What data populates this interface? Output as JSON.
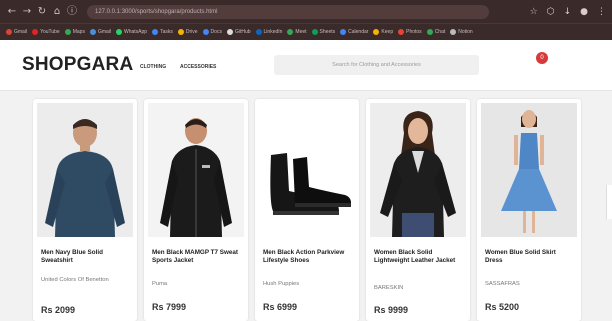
{
  "browser": {
    "url": "127.0.0.1:3000/sports/shopgara/products.html",
    "nav_icons": [
      "arrow-left-icon",
      "arrow-right-icon",
      "reload-icon",
      "home-icon",
      "lock-icon"
    ],
    "right_icons": [
      "star-icon",
      "extensions-icon",
      "downloads-icon",
      "profile-icon",
      "menu-icon"
    ],
    "bookmarks": [
      {
        "label": "Gmail",
        "color": "#d44638"
      },
      {
        "label": "YouTube",
        "color": "#e02424"
      },
      {
        "label": "Maps",
        "color": "#34a853"
      },
      {
        "label": "Gmail",
        "color": "#4a90d9"
      },
      {
        "label": "WhatsApp",
        "color": "#25d366"
      },
      {
        "label": "Tasks",
        "color": "#4285f4"
      },
      {
        "label": "Drive",
        "color": "#f4b400"
      },
      {
        "label": "Docs",
        "color": "#4285f4"
      },
      {
        "label": "GitHub",
        "color": "#dddddd"
      },
      {
        "label": "LinkedIn",
        "color": "#0a66c2"
      },
      {
        "label": "Meet",
        "color": "#34a853"
      },
      {
        "label": "Sheets",
        "color": "#0f9d58"
      },
      {
        "label": "Calendar",
        "color": "#4285f4"
      },
      {
        "label": "Keep",
        "color": "#f4b400"
      },
      {
        "label": "Photos",
        "color": "#ea4335"
      },
      {
        "label": "Chat",
        "color": "#34a853"
      },
      {
        "label": "Notion",
        "color": "#bbbbbb"
      }
    ]
  },
  "header": {
    "logo": "SHOPGARA",
    "nav": [
      "CLOTHING",
      "ACCESSORIES"
    ],
    "search_placeholder": "Search for Clothing and Accessories",
    "cart_count": "0"
  },
  "products": [
    {
      "name": "Men Navy Blue Solid Sweatshirt",
      "brand": "United Colors Of Benetton",
      "price": "Rs 2099",
      "image": "navy-sweatshirt"
    },
    {
      "name": "Men Black MAMGP T7 Sweat Sports Jacket",
      "brand": "Puma",
      "price": "Rs 7999",
      "image": "black-sports-jacket"
    },
    {
      "name": "Men Black Action Parkview Lifestyle Shoes",
      "brand": "Hush Puppies",
      "price": "Rs 6999",
      "image": "black-boots"
    },
    {
      "name": "Women Black Solid Lightweight Leather Jacket",
      "brand": "BARESKIN",
      "price": "Rs 9999",
      "image": "black-leather-jacket"
    },
    {
      "name": "Women Blue Solid Skirt Dress",
      "brand": "SASSAFRAS",
      "price": "Rs 5200",
      "image": "blue-dress"
    }
  ],
  "colors": {
    "brand_text": "#222222",
    "badge": "#d73a3a",
    "chrome": "#3a2a2a"
  }
}
